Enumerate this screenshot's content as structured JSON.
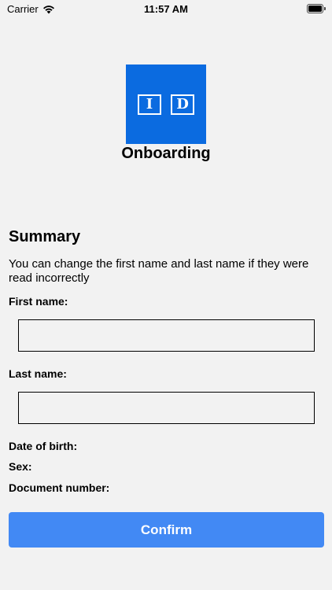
{
  "status_bar": {
    "carrier": "Carrier",
    "time": "11:57 AM"
  },
  "logo": {
    "left_letter": "I",
    "right_letter": "D",
    "color": "#0b6be0"
  },
  "app_title": "Onboarding",
  "summary": {
    "title": "Summary",
    "description": "You can change the first name and last name if they were read incorrectly"
  },
  "form": {
    "first_name_label": "First name:",
    "first_name_value": "",
    "last_name_label": "Last name:",
    "last_name_value": "",
    "date_of_birth_label": "Date of birth:",
    "sex_label": "Sex:",
    "document_number_label": "Document number:"
  },
  "confirm_button": {
    "label": "Confirm",
    "color": "#4289f4"
  },
  "icons": [
    "wifi-icon",
    "battery-icon"
  ]
}
